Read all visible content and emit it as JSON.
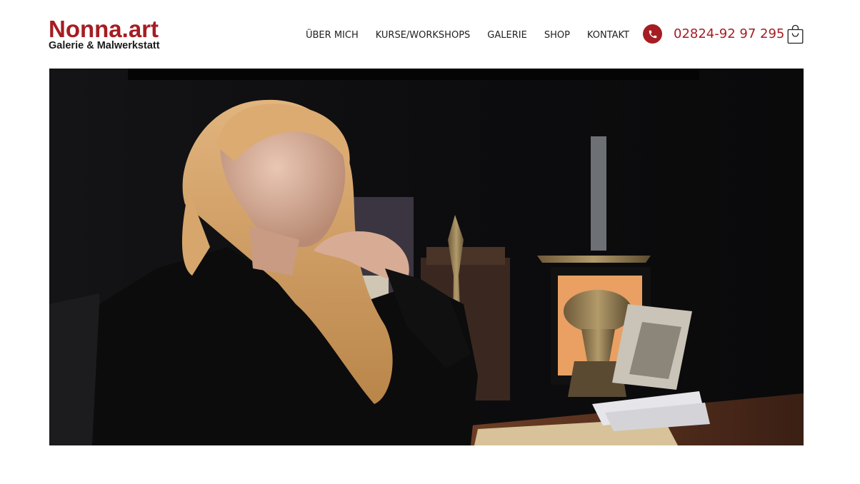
{
  "brand": {
    "name": "Nonna.art",
    "tagline": "Galerie & Malwerkstatt",
    "color": "#a51d22"
  },
  "nav": {
    "items": [
      {
        "label": "ÜBER MICH"
      },
      {
        "label": "KURSE/WORKSHOPS"
      },
      {
        "label": "GALERIE"
      },
      {
        "label": "SHOP"
      },
      {
        "label": "KONTAKT"
      }
    ]
  },
  "contact": {
    "phone": "02824-92 97 295",
    "phone_icon": "phone-icon"
  },
  "cart": {
    "icon": "shopping-bag-icon"
  },
  "hero": {
    "image": "portrait-photo"
  }
}
